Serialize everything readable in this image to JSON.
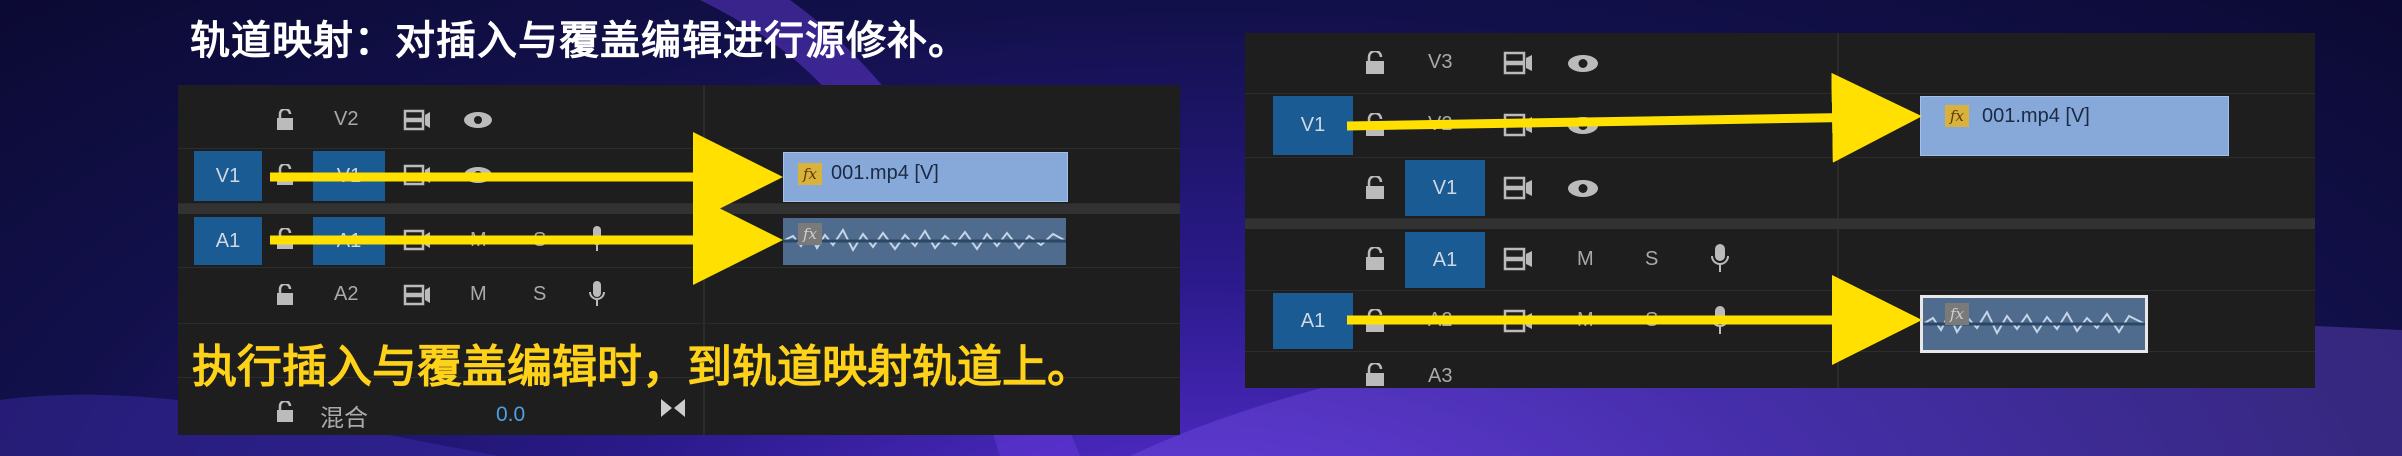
{
  "title": "轨道映射：对插入与覆盖编辑进行源修补。",
  "caption": "执行插入与覆盖编辑时，到轨道映射轨道上。",
  "left_panel": {
    "tracks": [
      {
        "source": "",
        "target": "V2"
      },
      {
        "source": "V1",
        "target": "V1"
      },
      {
        "source": "A1",
        "target": "A1"
      },
      {
        "source": "",
        "target": "A2"
      }
    ],
    "track_buttons": [
      "M",
      "S",
      "M",
      "S"
    ],
    "mix_label": "混合",
    "mix_value": "0.0",
    "video_clip": "001.mp4 [V]",
    "fx": "fx"
  },
  "right_panel": {
    "tracks": [
      {
        "source": "",
        "target": "V3"
      },
      {
        "source": "V1",
        "target": "V2"
      },
      {
        "source": "",
        "target": "V1"
      },
      {
        "source": "",
        "target": "A1"
      },
      {
        "source": "A1",
        "target": "A2"
      },
      {
        "source": "",
        "target": "A3"
      }
    ],
    "track_buttons": [
      "M",
      "S",
      "M",
      "S"
    ],
    "video_clip": "001.mp4 [V]",
    "fx": "fx"
  },
  "colors": {
    "arrow": "#ffe000",
    "caption": "#ffd21a",
    "track_target": "#1b5b94",
    "clip_video": "#86a9d9"
  }
}
